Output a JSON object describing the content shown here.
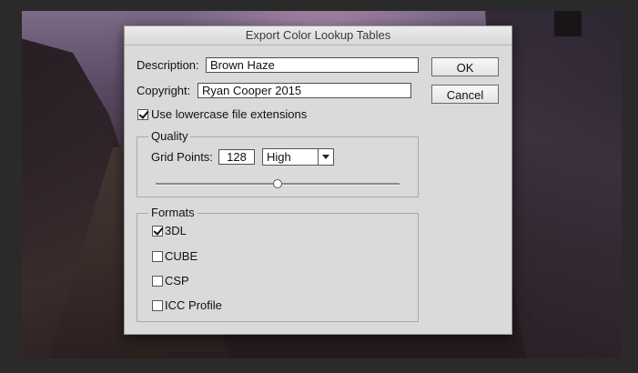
{
  "dialog": {
    "title": "Export Color Lookup Tables",
    "description": {
      "label": "Description:",
      "value": "Brown Haze"
    },
    "copyright": {
      "label": "Copyright:",
      "value": "Ryan Cooper 2015"
    },
    "lowercase_ext": {
      "label": "Use lowercase file extensions",
      "checked": true
    },
    "quality": {
      "title": "Quality",
      "grid_points_label": "Grid Points:",
      "grid_points_value": "128",
      "preset": "High",
      "slider_level": 0.5
    },
    "formats": {
      "title": "Formats",
      "items": [
        {
          "label": "3DL",
          "checked": true
        },
        {
          "label": "CUBE",
          "checked": false
        },
        {
          "label": "CSP",
          "checked": false
        },
        {
          "label": "ICC Profile",
          "checked": false
        }
      ]
    },
    "buttons": {
      "ok": "OK",
      "cancel": "Cancel"
    }
  }
}
